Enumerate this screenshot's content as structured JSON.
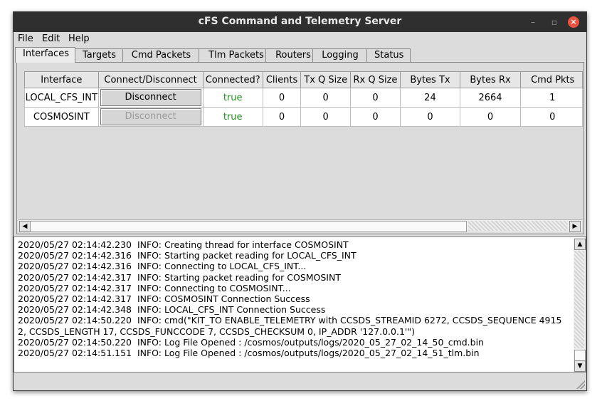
{
  "window": {
    "title": "cFS Command and Telemetry Server",
    "minimize": "–",
    "maximize": "▫",
    "close": "×"
  },
  "menu": [
    {
      "label": "File"
    },
    {
      "label": "Edit"
    },
    {
      "label": "Help"
    }
  ],
  "tabs": [
    {
      "label": "Interfaces",
      "active": true
    },
    {
      "label": "Targets"
    },
    {
      "label": "Cmd Packets"
    },
    {
      "label": "Tlm Packets"
    },
    {
      "label": "Routers"
    },
    {
      "label": "Logging"
    },
    {
      "label": "Status"
    }
  ],
  "table": {
    "headers": [
      "Interface",
      "Connect/Disconnect",
      "Connected?",
      "Clients",
      "Tx Q Size",
      "Rx Q Size",
      "Bytes Tx",
      "Bytes Rx",
      "Cmd Pkts"
    ],
    "rows": [
      {
        "interface": "LOCAL_CFS_INT",
        "button": "Disconnect",
        "button_enabled": true,
        "connected": "true",
        "clients": "0",
        "tx_q": "0",
        "rx_q": "0",
        "bytes_tx": "24",
        "bytes_rx": "2664",
        "cmd_pkts": "1"
      },
      {
        "interface": "COSMOSINT",
        "button": "Disconnect",
        "button_enabled": false,
        "connected": "true",
        "clients": "0",
        "tx_q": "0",
        "rx_q": "0",
        "bytes_tx": "0",
        "bytes_rx": "0",
        "cmd_pkts": "0"
      }
    ]
  },
  "log": [
    "2020/05/27 02:14:42.230  INFO: Creating thread for interface COSMOSINT",
    "2020/05/27 02:14:42.316  INFO: Starting packet reading for LOCAL_CFS_INT",
    "2020/05/27 02:14:42.316  INFO: Connecting to LOCAL_CFS_INT...",
    "2020/05/27 02:14:42.317  INFO: Starting packet reading for COSMOSINT",
    "2020/05/27 02:14:42.317  INFO: Connecting to COSMOSINT...",
    "2020/05/27 02:14:42.317  INFO: COSMOSINT Connection Success",
    "2020/05/27 02:14:42.348  INFO: LOCAL_CFS_INT Connection Success",
    "2020/05/27 02:14:50.220  INFO: cmd(\"KIT_TO ENABLE_TELEMETRY with CCSDS_STREAMID 6272, CCSDS_SEQUENCE 49152, CCSDS_LENGTH 17, CCSDS_FUNCCODE 7, CCSDS_CHECKSUM 0, IP_ADDR '127.0.0.1'\")",
    "2020/05/27 02:14:50.220  INFO: Log File Opened : /cosmos/outputs/logs/2020_05_27_02_14_50_cmd.bin",
    "2020/05/27 02:14:51.151  INFO: Log File Opened : /cosmos/outputs/logs/2020_05_27_02_14_51_tlm.bin"
  ],
  "colors": {
    "titlebar": "#2f2f2f",
    "close_button": "#e9523e",
    "connected_true": "#1f8f1f",
    "window_bg": "#dcdcdc"
  },
  "icons": {
    "scroll_left": "◀",
    "scroll_right": "▶",
    "scroll_up": "▲",
    "scroll_down": "▼"
  }
}
